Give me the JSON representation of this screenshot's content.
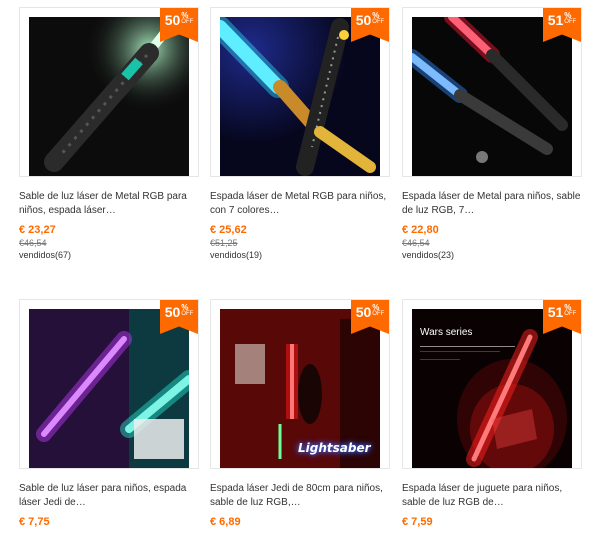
{
  "products": [
    {
      "discount_num": "50",
      "discount_pct": "%",
      "discount_off": "OFF",
      "title": "Sable de luz láser de Metal RGB para niños, espada láser…",
      "price": "€ 23,27",
      "original": "€46,54",
      "sold": "vendidos(67)",
      "image_icon": "green-lightsaber-image"
    },
    {
      "discount_num": "50",
      "discount_pct": "%",
      "discount_off": "OFF",
      "title": "Espada láser de Metal RGB para niños, con 7 colores…",
      "price": "€ 25,62",
      "original": "€51,25",
      "sold": "vendidos(19)",
      "image_icon": "cyan-gold-lightsaber-image"
    },
    {
      "discount_num": "51",
      "discount_pct": "%",
      "discount_off": "OFF",
      "title": "Espada láser de Metal para niños, sable de luz RGB, 7…",
      "price": "€ 22,80",
      "original": "€46,54",
      "sold": "vendidos(23)",
      "image_icon": "red-blue-lightsabers-image"
    },
    {
      "discount_num": "50",
      "discount_pct": "%",
      "discount_off": "OFF",
      "title": "Sable de luz láser para niños, espada láser Jedi de…",
      "price": "€ 7,75",
      "original": "",
      "sold": "",
      "image_icon": "purple-cyan-lightsabers-image"
    },
    {
      "discount_num": "50",
      "discount_pct": "%",
      "discount_off": "OFF",
      "title": "Espada láser Jedi de 80cm para niños, sable de luz RGB,…",
      "price": "€ 6,89",
      "original": "",
      "sold": "",
      "image_icon": "red-room-lightsaber-image",
      "image_caption": "Lightsaber"
    },
    {
      "discount_num": "51",
      "discount_pct": "%",
      "discount_off": "OFF",
      "title": "Espada láser de juguete para niños, sable de luz RGB de…",
      "price": "€ 7,59",
      "original": "",
      "sold": "",
      "image_icon": "red-hoodie-lightsaber-image",
      "image_caption": "Wars series"
    }
  ],
  "colors": {
    "accent": "#ff6a00",
    "text": "#333333",
    "muted": "#777777"
  }
}
